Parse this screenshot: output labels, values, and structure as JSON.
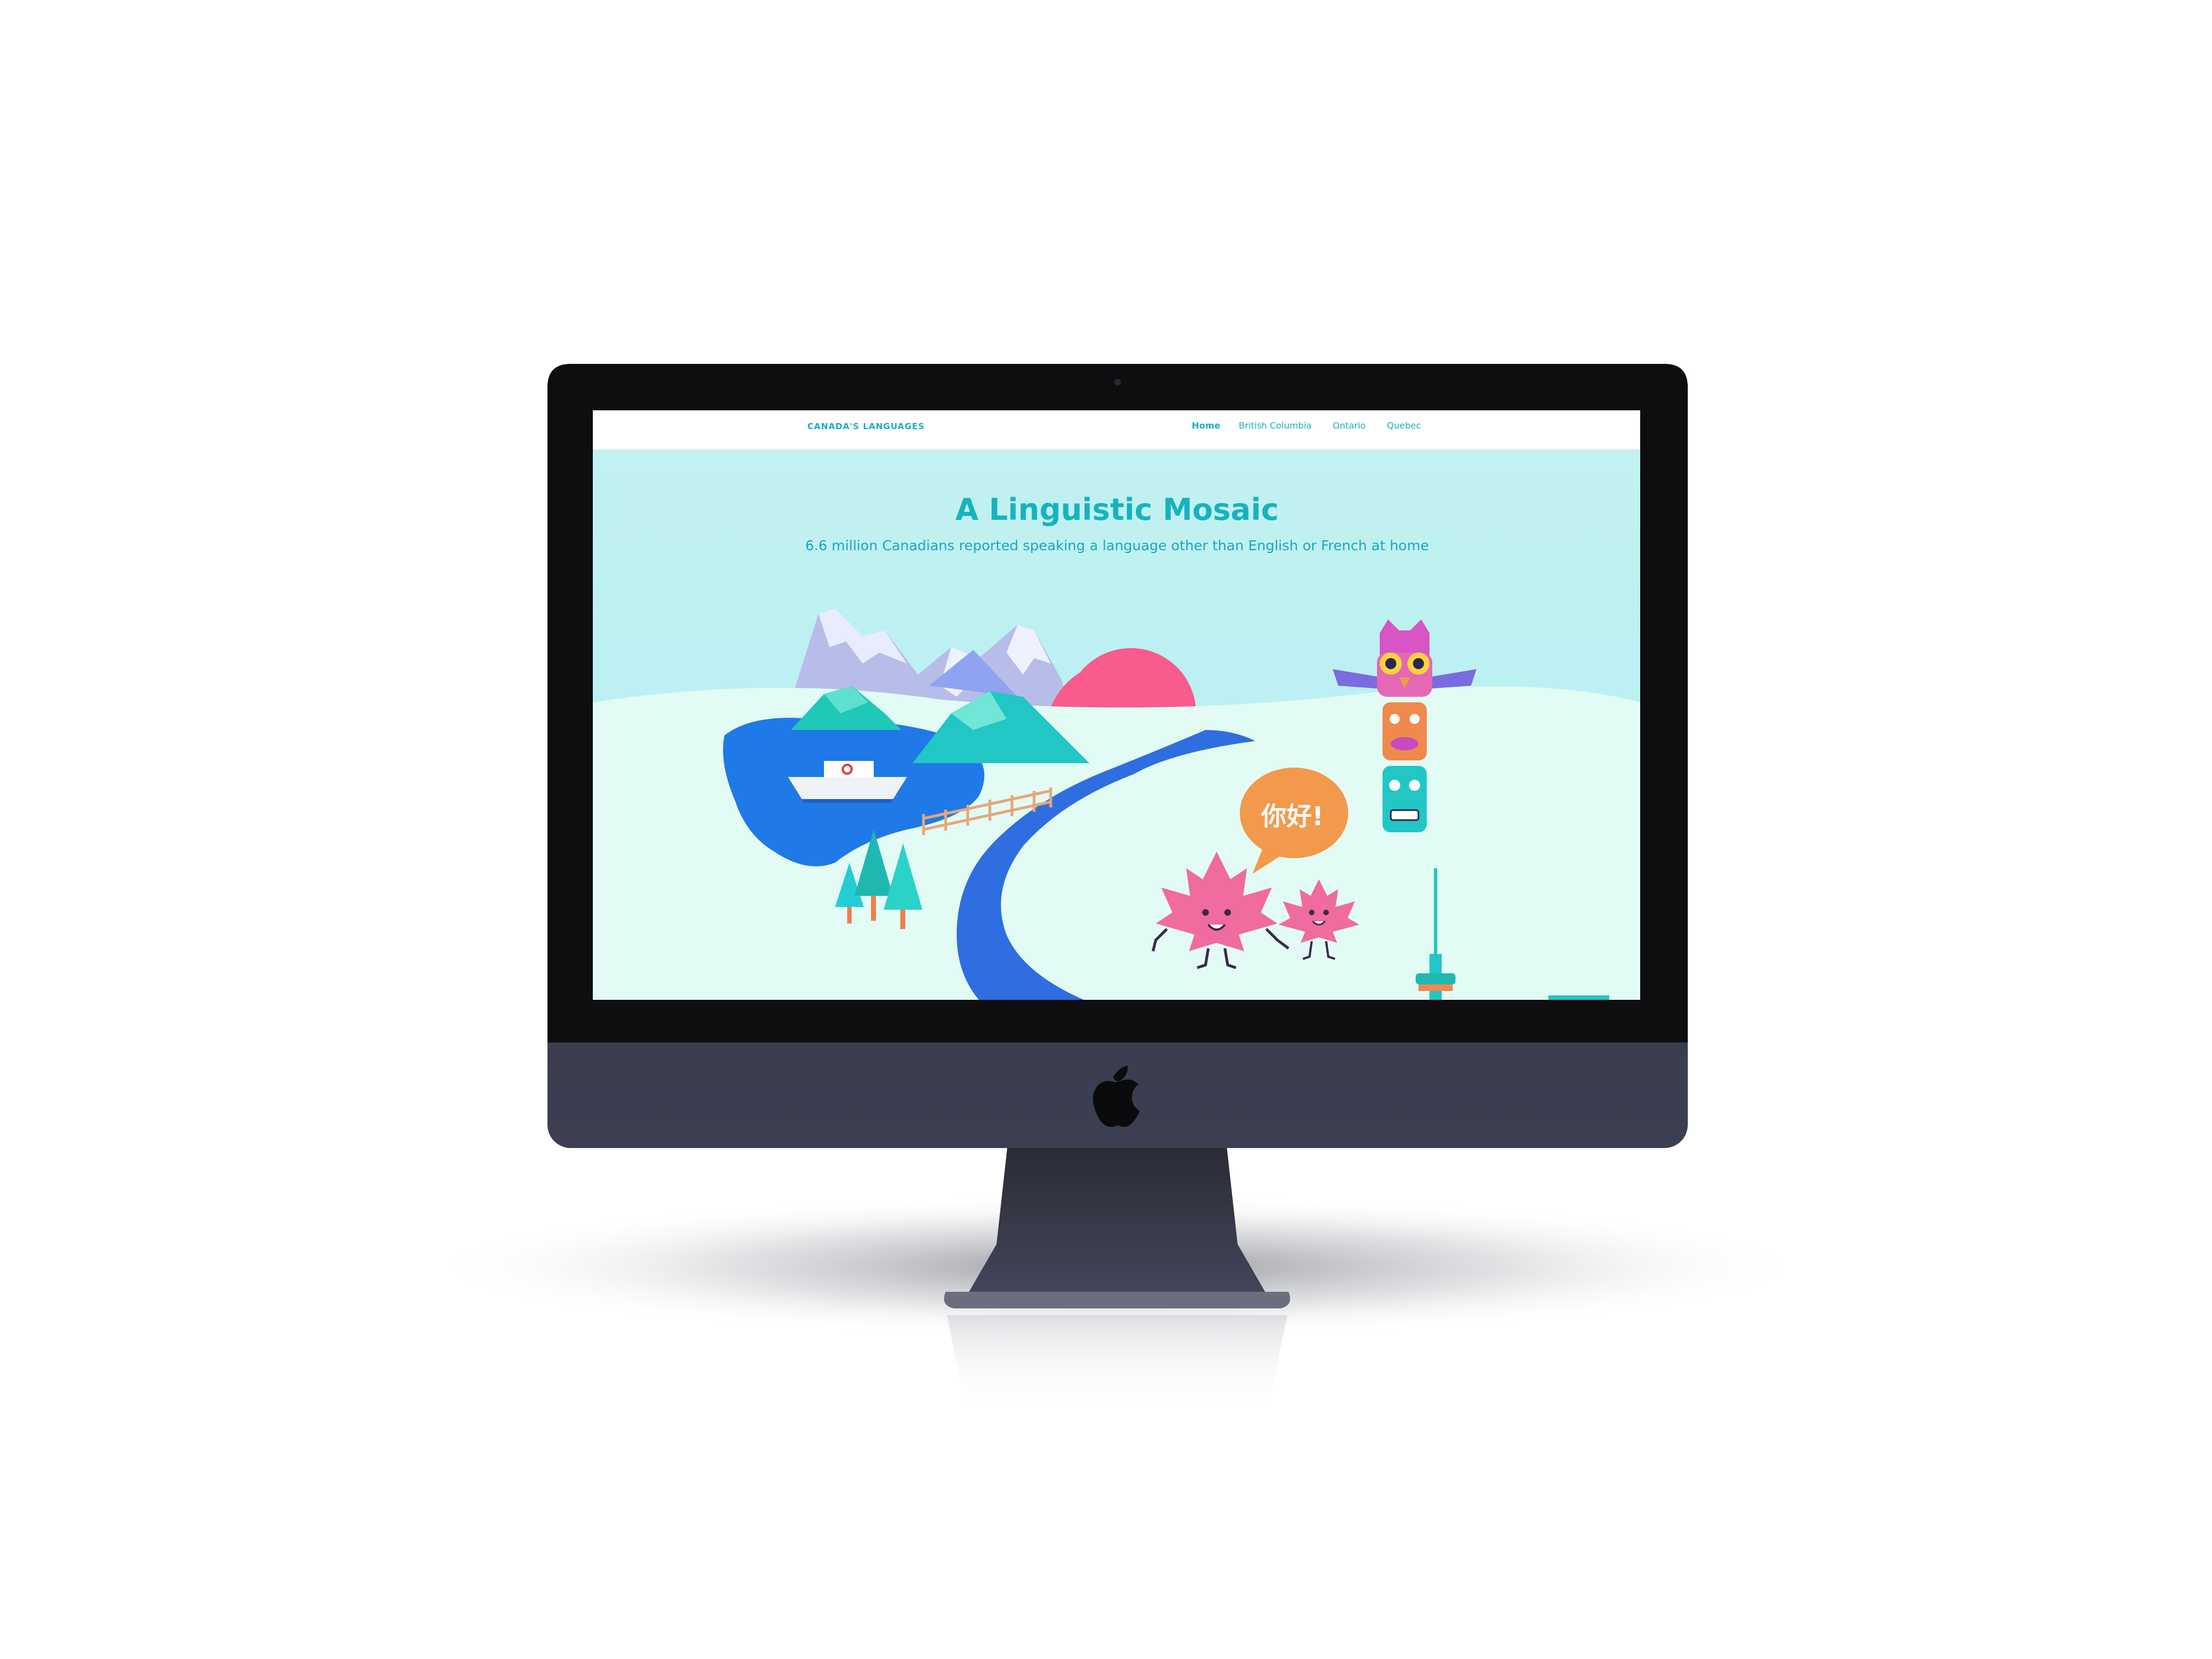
{
  "nav": {
    "brand": "CANADA'S LANGUAGES",
    "items": [
      {
        "label": "Home",
        "active": true
      },
      {
        "label": "British Columbia",
        "active": false
      },
      {
        "label": "Ontario",
        "active": false
      },
      {
        "label": "Quebec",
        "active": false
      }
    ]
  },
  "hero": {
    "title": "A Linguistic Mosaic",
    "subtitle": "6.6 million Canadians reported speaking a language other than English or French at home"
  },
  "illustration": {
    "speech_bubble_text": "你好!"
  },
  "colors": {
    "accent": "#17b2bf",
    "sky_top": "#c4f3f2",
    "sky_bottom": "#b8f1f7",
    "ground": "#e2fbf5",
    "river": "#2f6ee0",
    "lake": "#1f79e6",
    "sun": "#f85b8c",
    "bubble": "#f2994c",
    "maple_leaf": "#f06b9e",
    "device_bezel": "#101010",
    "device_chin": "#2f3140"
  },
  "device": {
    "logo_icon": "apple-logo-icon"
  }
}
